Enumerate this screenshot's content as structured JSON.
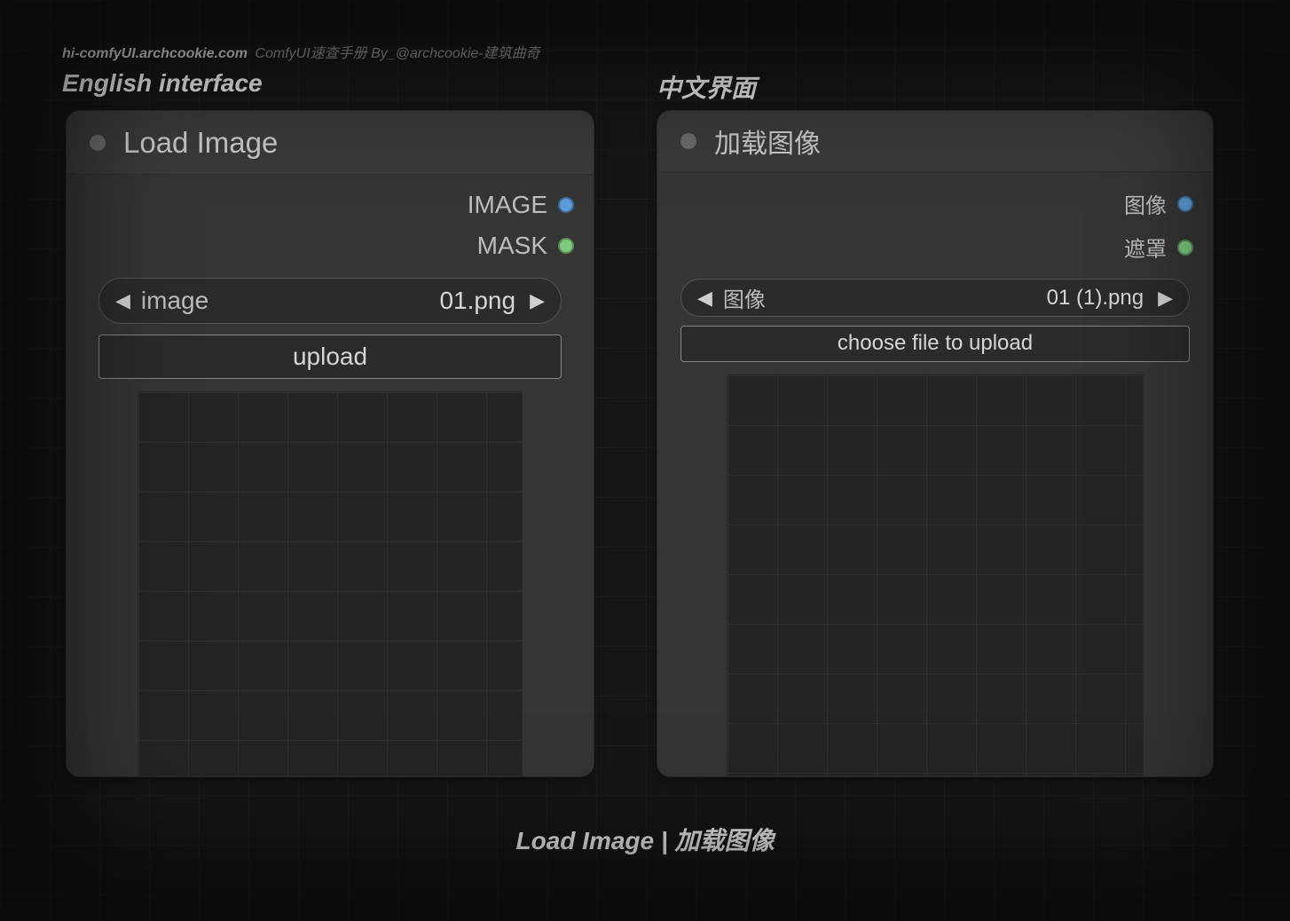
{
  "header": {
    "domain": "hi-comfyUI.archcookie.com",
    "muted": "ComfyUI速查手册 By_@archcookie-建筑曲奇"
  },
  "labels": {
    "english_section": "English interface",
    "chinese_section": "中文界面"
  },
  "node_en": {
    "title": "Load Image",
    "outputs": {
      "image": "IMAGE",
      "mask": "MASK"
    },
    "selector": {
      "label": "image",
      "value": "01.png"
    },
    "upload_label": "upload"
  },
  "node_cn": {
    "title": "加载图像",
    "outputs": {
      "image": "图像",
      "mask": "遮罩"
    },
    "selector": {
      "label": "图像",
      "value": "01 (1).png"
    },
    "upload_label": "choose file to upload"
  },
  "caption": "Load Image | 加载图像",
  "colors": {
    "image_port": "#5b9dd9",
    "mask_port": "#7fc97f"
  }
}
